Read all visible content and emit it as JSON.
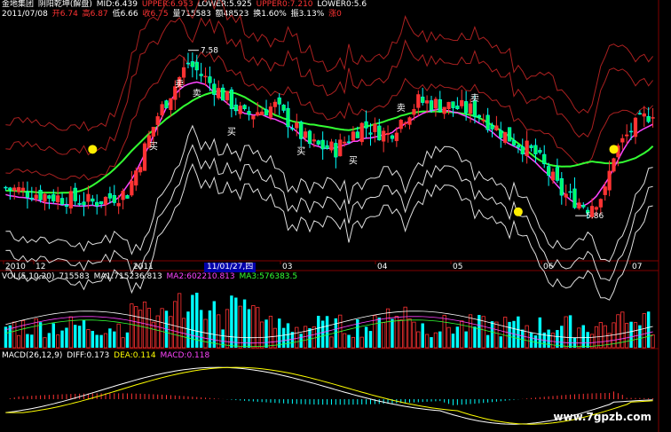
{
  "header": {
    "stock_name": "金地集团",
    "indicator": "阴阳乾坤(解盘)",
    "mid": "MID:6.439",
    "upper": "UPPER:6.953",
    "lower": "LOWER:5.925",
    "upper0": "UPPER0:7.210",
    "lower0": "LOWER0:5.6",
    "date": "2011/07/08",
    "open": "开6.74",
    "high": "高6.87",
    "low": "低6.66",
    "close": "收6.75",
    "volume": "量715583",
    "amount": "额48523",
    "turnover": "换1.60%",
    "amplitude": "振3.13%",
    "change": "涨0"
  },
  "vol_header": {
    "name": "VOL(5,10,20)",
    "vol": "715583",
    "ma1": "MA1:715236.813",
    "ma2": "MA2:602210.813",
    "ma3": "MA3:576383.5"
  },
  "macd_header": {
    "name": "MACD(26,12,9)",
    "diff": "DIFF:0.173",
    "dea": "DEA:0.114",
    "macd": "MACD:0.118"
  },
  "axis": {
    "x_labels": [
      "2010",
      "12",
      "2011",
      "11/01/27,四",
      "03",
      "04",
      "05",
      "06",
      "07"
    ]
  },
  "annotations": {
    "high_label": "7.58",
    "low_label": "5.86",
    "buy_label": "买",
    "sell_label": "卖"
  },
  "watermark": "www.7gpzb.com",
  "colors": {
    "up": "#ff3333",
    "down": "#00ffff",
    "ma_green": "#33ff33",
    "ma_magenta": "#ff44ff",
    "band_red": "#aa2020",
    "band_white": "#dddddd",
    "grid_red": "#800000"
  },
  "chart_data": {
    "type": "candlestick",
    "price_range": [
      5.4,
      7.9
    ],
    "annotated_high": 7.58,
    "annotated_low": 5.86,
    "last_bar": {
      "open": 6.74,
      "high": 6.87,
      "low": 6.66,
      "close": 6.75,
      "volume": 715583
    },
    "bollinger": {
      "mid": 6.439,
      "upper": 6.953,
      "lower": 5.925,
      "upper0": 7.21,
      "lower0": 5.6
    },
    "volume_ma": {
      "ma1": 715236.813,
      "ma2": 602210.813,
      "ma3": 576383.5
    },
    "macd": {
      "diff": 0.173,
      "dea": 0.114,
      "macd": 0.118
    }
  }
}
